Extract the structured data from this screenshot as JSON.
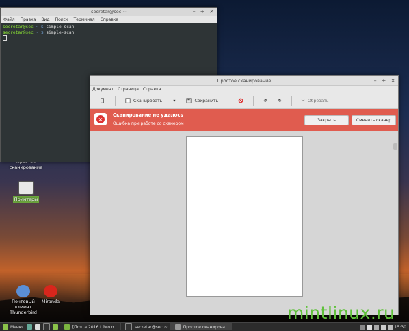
{
  "desktop": {
    "icons": [
      {
        "label": "Простое сканирование",
        "icon": "scanner-app-icon"
      },
      {
        "label": "Принтеры",
        "icon": "printer-icon"
      },
      {
        "label": "Почтовый клиент Thunderbird",
        "icon": "thunderbird-icon"
      },
      {
        "label": "Miranda",
        "icon": "miranda-icon"
      }
    ]
  },
  "terminal": {
    "title": "secretar@sec ~",
    "menu": [
      "Файл",
      "Правка",
      "Вид",
      "Поиск",
      "Терминал",
      "Справка"
    ],
    "lines": [
      {
        "user": "secretar@sec",
        "path": "~ $",
        "cmd": " simple-scan"
      },
      {
        "user": "secretar@sec",
        "path": "~ $",
        "cmd": " simple-scan"
      }
    ]
  },
  "scan_window": {
    "title": "Простое сканирование",
    "menu": [
      "Документ",
      "Страница",
      "Справка"
    ],
    "toolbar": {
      "scan_label": "Сканировать",
      "save_label": "Сохранить",
      "crop_label": "Обрезать"
    },
    "error": {
      "title": "Сканирование не удалось",
      "message": "Ошибка при работе со сканером",
      "close_label": "Закрыть",
      "change_scanner_label": "Сменить сканер",
      "color": "#e05c4f"
    }
  },
  "panel": {
    "menu_label": "Меню",
    "tasks": [
      "[Почта 2016 Libro.o...",
      "secretar@sec ~",
      "Простое сканирова..."
    ],
    "clock": "15:30"
  },
  "watermark": "mintlinux.ru"
}
